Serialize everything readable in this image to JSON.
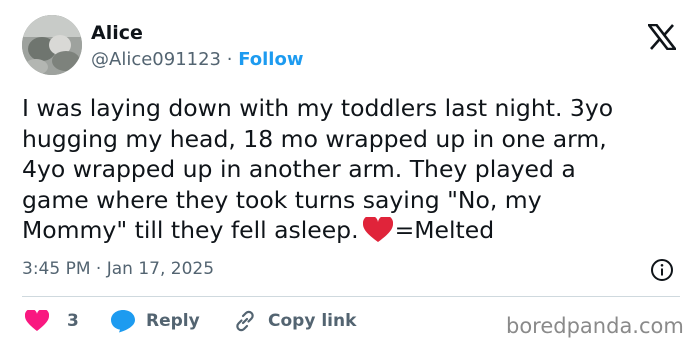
{
  "author": {
    "name": "Alice",
    "handle": "@Alice091123",
    "separator": "·",
    "follow_label": "Follow"
  },
  "tweet": {
    "lines": [
      "I was laying down with my toddlers last night. 3yo",
      "hugging my head, 18 mo wrapped up in one arm,",
      "4yo wrapped up in another arm. They played a",
      "game where they took turns saying \"No, my"
    ],
    "last_line_before_emoji": "Mommy\" till they fell asleep.",
    "last_line_after_emoji": "=Melted"
  },
  "meta": {
    "time": "3:45 PM",
    "separator": "·",
    "date": "Jan 17, 2025"
  },
  "actions": {
    "like_count": "3",
    "reply_label": "Reply",
    "copy_link_label": "Copy link"
  },
  "watermark": "boredpanda.com",
  "colors": {
    "accent": "#1d9bf0",
    "heart": "#f91880",
    "muted": "#536471",
    "emoji_heart": "#e0243a"
  },
  "icons": [
    "x-logo-icon",
    "heart-emoji-icon",
    "info-icon",
    "heart-icon",
    "reply-icon",
    "link-icon"
  ]
}
